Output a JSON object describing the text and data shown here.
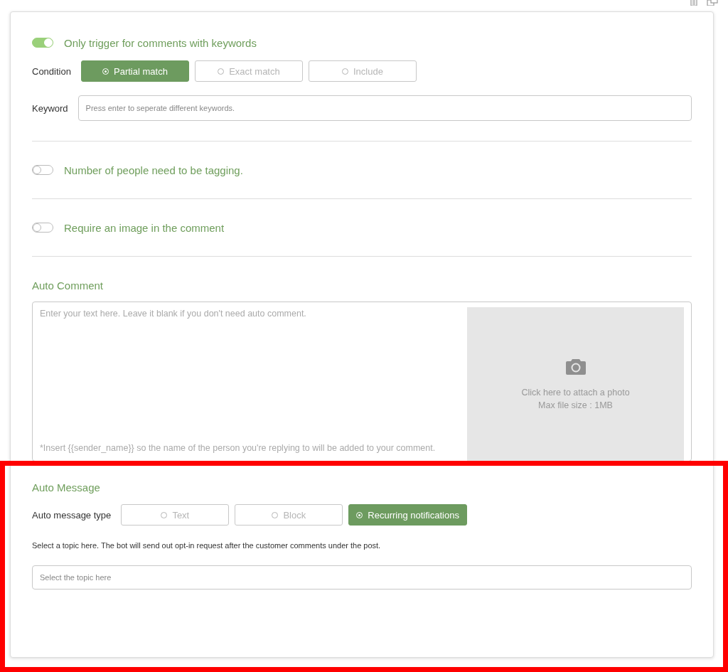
{
  "keyword_trigger": {
    "label": "Only trigger for comments with keywords",
    "on": true,
    "condition_label": "Condition",
    "conditions": [
      {
        "label": "Partial match",
        "selected": true
      },
      {
        "label": "Exact match",
        "selected": false
      },
      {
        "label": "Include",
        "selected": false
      }
    ],
    "keyword_label": "Keyword",
    "keyword_placeholder": "Press enter to seperate different keywords."
  },
  "tagging_toggle": {
    "label": "Number of people need to be tagging.",
    "on": false
  },
  "image_toggle": {
    "label": "Require an image in the comment",
    "on": false
  },
  "auto_comment": {
    "title": "Auto Comment",
    "placeholder": "Enter your text here. Leave it blank if you don't need auto comment.",
    "hint": "*Insert {{sender_name}} so the name of the person you're replying to will be added to your comment.",
    "photo_label": "Click here to attach a photo",
    "photo_size": "Max file size : 1MB"
  },
  "auto_message": {
    "title": "Auto Message",
    "type_label": "Auto message type",
    "types": [
      {
        "label": "Text",
        "selected": false
      },
      {
        "label": "Block",
        "selected": false
      },
      {
        "label": "Recurring notifications",
        "selected": true
      }
    ],
    "help": "Select a topic here. The bot will send out opt-in request after the customer comments under the post.",
    "topic_placeholder": "Select the topic here"
  }
}
